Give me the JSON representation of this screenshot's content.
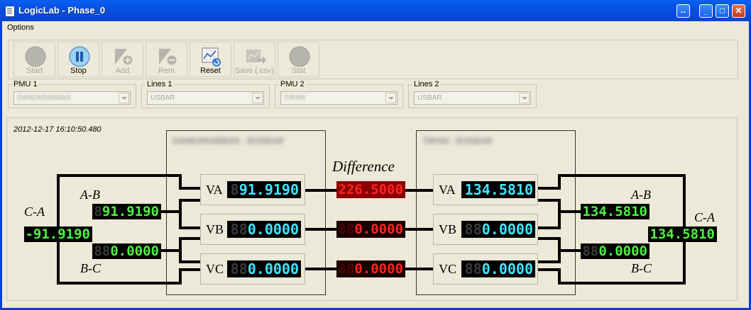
{
  "window": {
    "title": "LogicLab - Phase_0"
  },
  "menu": {
    "options": "Options"
  },
  "toolbar": {
    "start": "Start",
    "stop": "Stop",
    "add": "Add",
    "rem": "Rem",
    "reset": "Reset",
    "save": "Save (.csv)",
    "stat": "Stat"
  },
  "selectors": {
    "pmu1": {
      "label": "PMU 1",
      "value": "DANDARABBAS"
    },
    "lines1": {
      "label": "Lines 1",
      "value": "USBAR"
    },
    "pmu2": {
      "label": "PMU 2",
      "value": "TIRAN"
    },
    "lines2": {
      "label": "Lines 2",
      "value": "USBAR"
    }
  },
  "timestamp": "2012-12-17 16:10:50.480",
  "left_box": {
    "header": "DANDARABBAS - EUSBAR"
  },
  "right_box": {
    "header": "TIRAN - EUSBAR"
  },
  "difference": {
    "label": "Difference",
    "va_ghost": "",
    "va": "226.5000",
    "vb_ghost": "88",
    "vb": "0.0000",
    "vc_ghost": "88",
    "vc": "0.0000"
  },
  "left": {
    "va_label": "VA",
    "va_ghost": "8",
    "va": "91.9190",
    "vb_label": "VB",
    "vb_ghost": "88",
    "vb": "0.0000",
    "vc_label": "VC",
    "vc_ghost": "88",
    "vc": "0.0000",
    "ab_label": "A-B",
    "ab_ghost": "8",
    "ab": "91.9190",
    "bc_label": "B-C",
    "bc_ghost": "88",
    "bc": "0.0000",
    "ca_label": "C-A",
    "ca": "-91.9190"
  },
  "right": {
    "va_label": "VA",
    "va": "134.5810",
    "vb_label": "VB",
    "vb_ghost": "88",
    "vb": "0.0000",
    "vc_label": "VC",
    "vc_ghost": "88",
    "vc": "0.0000",
    "ab_label": "A-B",
    "ab": "134.5810",
    "bc_label": "B-C",
    "bc_ghost": "88",
    "bc": "0.0000",
    "ca_label": "C-A",
    "ca": "134.5810"
  },
  "colors": {
    "titlebar": "#0751e0",
    "lcd_phase": "#40e5ff",
    "lcd_line": "#4ff241",
    "lcd_diff": "#ff2424"
  }
}
